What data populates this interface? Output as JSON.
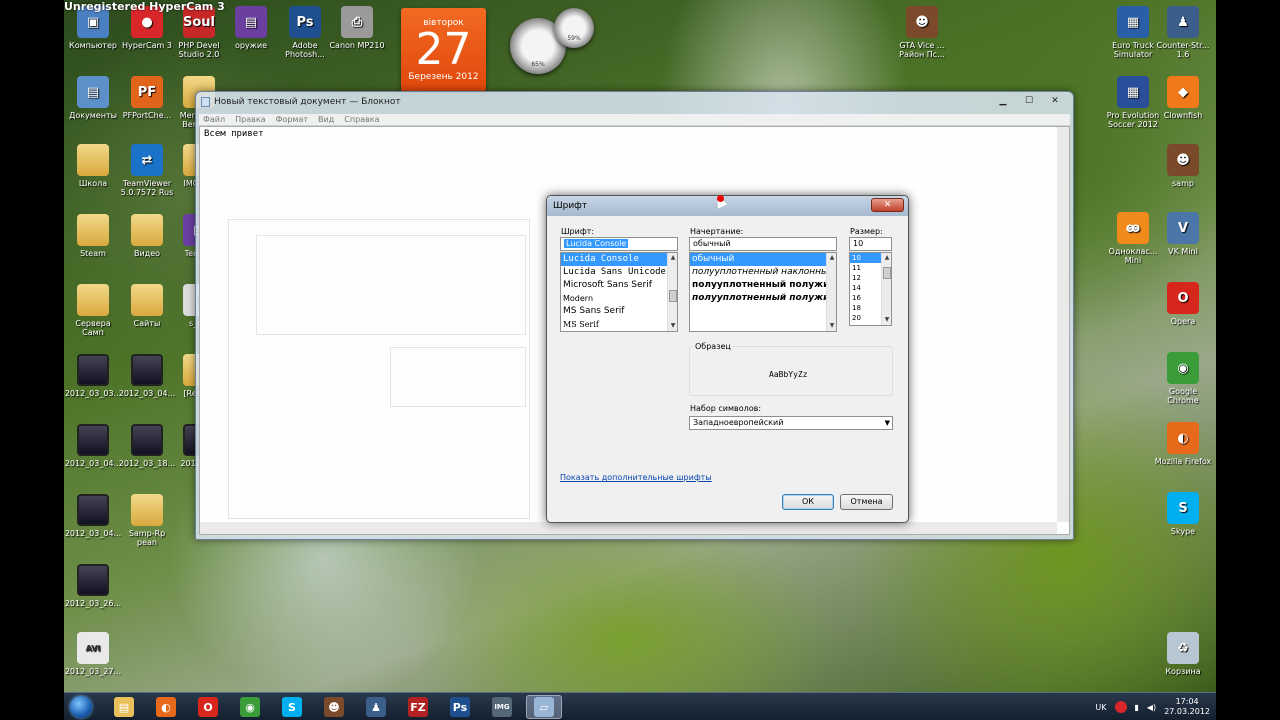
{
  "watermark": "Unregistered HyperCam 3",
  "desktop_icons_left": [
    {
      "label": "Компьютер",
      "icon": "computer-icon",
      "glyph": "▣",
      "color": "#4a7fc1"
    },
    {
      "label": "HyperCam 3",
      "icon": "hypercam-icon",
      "glyph": "●",
      "color": "#d9262b"
    },
    {
      "label": "PHP Devel Studio 2.0",
      "icon": "php-devel-studio-icon",
      "glyph": "Soul",
      "color": "#c62828"
    },
    {
      "label": "оружие",
      "icon": "weapons-archive-icon",
      "glyph": "▤",
      "color": "#6a3fa0"
    },
    {
      "label": "Adobe Photosh...",
      "icon": "photoshop-icon",
      "glyph": "Ps",
      "color": "#1f4f8f"
    },
    {
      "label": "Canon MP210",
      "icon": "printer-icon",
      "glyph": "⎙",
      "color": "#9a9a9a"
    },
    {
      "label": "Документы",
      "icon": "documents-icon",
      "glyph": "▤",
      "color": "#5d8fc9"
    },
    {
      "label": "PFPortChe...",
      "icon": "pfportcheck-icon",
      "glyph": "PF",
      "color": "#e0651a"
    },
    {
      "label": "Mercedes Benz P...",
      "icon": "folder-icon",
      "glyph": "",
      "color": ""
    },
    {
      "label": "Школа",
      "icon": "folder-icon",
      "glyph": "",
      "color": ""
    },
    {
      "label": "TeamViewer 5.0.7572 Rus",
      "icon": "teamviewer-icon",
      "glyph": "⇄",
      "color": "#1a73c9"
    },
    {
      "label": "IMGTo...",
      "icon": "folder-icon",
      "glyph": "",
      "color": ""
    },
    {
      "label": "Steam",
      "icon": "folder-icon",
      "glyph": "",
      "color": ""
    },
    {
      "label": "Видео",
      "icon": "folder-icon",
      "glyph": "",
      "color": ""
    },
    {
      "label": "Team...",
      "icon": "winrar-icon",
      "glyph": "▤",
      "color": "#6a3fa0"
    },
    {
      "label": "Сервера Самп",
      "icon": "folder-icon",
      "glyph": "",
      "color": ""
    },
    {
      "label": "Сайты",
      "icon": "folder-icon",
      "glyph": "",
      "color": ""
    },
    {
      "label": "s_s...",
      "icon": "file-icon",
      "glyph": "▯",
      "color": "#dddddd"
    },
    {
      "label": "2012_03_03...",
      "icon": "video-file-icon",
      "glyph": "",
      "color": ""
    },
    {
      "label": "2012_03_04...",
      "icon": "video-file-icon",
      "glyph": "",
      "color": ""
    },
    {
      "label": "[Real]...",
      "icon": "folder-icon",
      "glyph": "",
      "color": ""
    },
    {
      "label": "2012_03_04...",
      "icon": "video-file-icon",
      "glyph": "",
      "color": ""
    },
    {
      "label": "2012_03_18...",
      "icon": "video-file-icon",
      "glyph": "",
      "color": ""
    },
    {
      "label": "2012_0...",
      "icon": "video-file-icon",
      "glyph": "",
      "color": ""
    },
    {
      "label": "2012_03_04...",
      "icon": "video-file-icon",
      "glyph": "",
      "color": ""
    },
    {
      "label": "Samp-Rp pean",
      "icon": "folder-icon",
      "glyph": "",
      "color": ""
    },
    {
      "label": "2012_03_26...",
      "icon": "video-file-icon",
      "glyph": "",
      "color": ""
    },
    {
      "label": "2012_03_27...",
      "icon": "avi-file-icon",
      "glyph": "AVI",
      "color": "#e9e9e9"
    }
  ],
  "desktop_icons_right": [
    {
      "label": "GTA Vice ... Район Пс...",
      "icon": "gta-icon",
      "glyph": "☻",
      "color": "#7a4a2a"
    },
    {
      "label": "Euro Truck Simulator",
      "icon": "euro-truck-icon",
      "glyph": "▦",
      "color": "#2a5fa8"
    },
    {
      "label": "Counter-Str... 1.6",
      "icon": "counter-strike-icon",
      "glyph": "♟",
      "color": "#3b5e8a"
    },
    {
      "label": "Pro Evolution Soccer 2012",
      "icon": "pes-icon",
      "glyph": "▦",
      "color": "#2a4f9a"
    },
    {
      "label": "Clownfish",
      "icon": "clownfish-icon",
      "glyph": "◆",
      "color": "#f07a1a"
    },
    {
      "label": "samp",
      "icon": "samp-icon",
      "glyph": "☻",
      "color": "#7a4a2a"
    },
    {
      "label": "Одноклас... Mini",
      "icon": "odnoklassniki-icon",
      "glyph": "ꙭ",
      "color": "#f08a1a"
    },
    {
      "label": "VK Mini",
      "icon": "vk-icon",
      "glyph": "V",
      "color": "#4a76a8"
    },
    {
      "label": "Opera",
      "icon": "opera-icon",
      "glyph": "O",
      "color": "#d7261b"
    },
    {
      "label": "Google Chrome",
      "icon": "chrome-icon",
      "glyph": "◉",
      "color": "#3a9d3a"
    },
    {
      "label": "Mozilla Firefox",
      "icon": "firefox-icon",
      "glyph": "◐",
      "color": "#e66a1a"
    },
    {
      "label": "Skype",
      "icon": "skype-icon",
      "glyph": "S",
      "color": "#00aff0"
    },
    {
      "label": "Корзина",
      "icon": "recycle-bin-icon",
      "glyph": "♻",
      "color": "#b8c6d4"
    }
  ],
  "calendar": {
    "weekday": "вівторок",
    "day": "27",
    "month": "Березень 2012"
  },
  "gauges": [
    {
      "value": "65%"
    },
    {
      "value": "59%"
    }
  ],
  "notepad": {
    "title": "Новый текстовый документ — Блокнот",
    "menu": [
      "Файл",
      "Правка",
      "Формат",
      "Вид",
      "Справка"
    ],
    "content": "Всем привет",
    "buttons": {
      "minimize": "▁",
      "maximize": "☐",
      "close": "✕"
    }
  },
  "font_dialog": {
    "title": "Шрифт",
    "close": "✕",
    "font_label": "Шрифт:",
    "font_value": "Lucida Console",
    "fonts": [
      "Lucida Console",
      "Lucida Sans Unicode",
      "Microsoft Sans Serif",
      "Modern",
      "MS Sans Serif",
      "MS Serif"
    ],
    "style_label": "Начертание:",
    "style_value": "обычный",
    "styles": [
      "обычный",
      "полууплотненный наклонный",
      "полууплотненный полужирный",
      "полууплотненный полужирный наклонный"
    ],
    "size_label": "Размер:",
    "size_value": "10",
    "sizes": [
      "10",
      "11",
      "12",
      "14",
      "16",
      "18",
      "20"
    ],
    "sample_label": "Образец",
    "sample_text": "AaBbYyZz",
    "charset_label": "Набор символов:",
    "charset_value": "Западноевропейский",
    "more_fonts_link": "Показать дополнительные шрифты",
    "ok": "ОК",
    "cancel": "Отмена"
  },
  "taskbar": {
    "items": [
      {
        "icon": "explorer-icon",
        "glyph": "▤",
        "color": "#e8c15a"
      },
      {
        "icon": "firefox-icon",
        "glyph": "◐",
        "color": "#e66a1a"
      },
      {
        "icon": "opera-icon",
        "glyph": "O",
        "color": "#d7261b"
      },
      {
        "icon": "chrome-icon",
        "glyph": "◉",
        "color": "#3a9d3a"
      },
      {
        "icon": "skype-icon",
        "glyph": "S",
        "color": "#00aff0"
      },
      {
        "icon": "samp-icon",
        "glyph": "☻",
        "color": "#7a4a2a"
      },
      {
        "icon": "counter-strike-icon",
        "glyph": "♟",
        "color": "#3b5e8a"
      },
      {
        "icon": "filezilla-icon",
        "glyph": "FZ",
        "color": "#b22222"
      },
      {
        "icon": "photoshop-icon",
        "glyph": "Ps",
        "color": "#1f4f8f"
      },
      {
        "icon": "imgtool-icon",
        "glyph": "IMG",
        "color": "#556677"
      },
      {
        "icon": "notepad-icon",
        "glyph": "▱",
        "color": "#9ab6d6"
      }
    ],
    "language": "UK",
    "time": "17:04",
    "date": "27.03.2012"
  }
}
